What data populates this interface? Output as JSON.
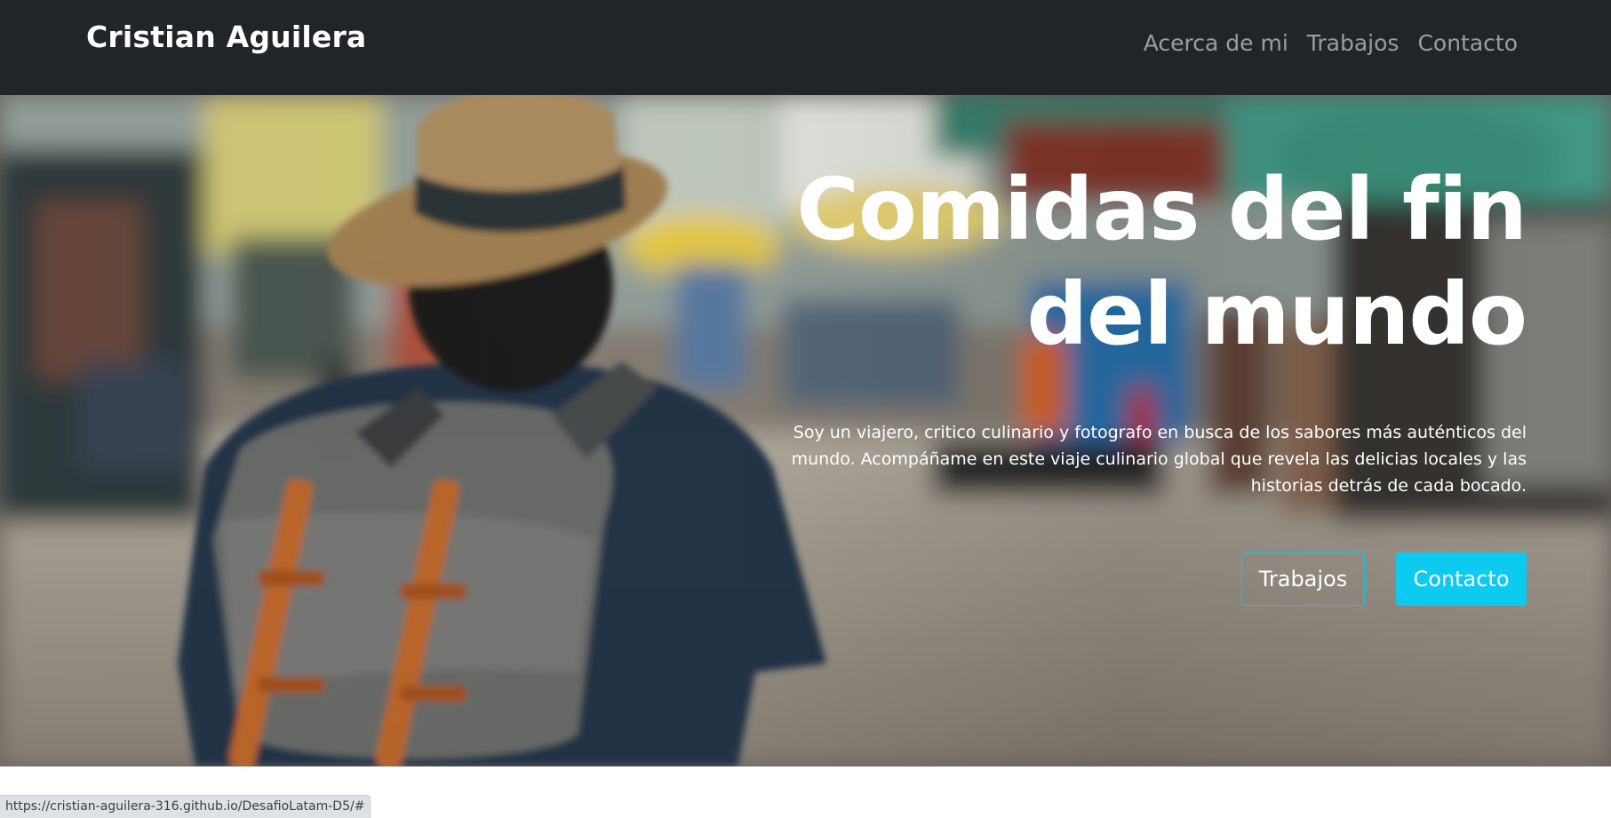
{
  "navbar": {
    "brand": "Cristian Aguilera",
    "links": [
      "Acerca de mi",
      "Trabajos",
      "Contacto"
    ]
  },
  "hero": {
    "title": "Comidas del fin del mundo",
    "description": "Soy un viajero, critico culinario y fotografo en busca de los sabores más auténticos del mundo. Acompáñame en este viaje culinario global que revela las delicias locales y las historias detrás de cada bocado.",
    "buttons": {
      "outline_label": "Trabajos",
      "solid_label": "Contacto"
    },
    "background_icon": "traveler-market-photo"
  },
  "status_bar": {
    "url": "https://cristian-aguilera-316.github.io/DesafioLatam-D5/#"
  },
  "colors": {
    "navbar_bg": "#212529",
    "accent": "#0dcaf0",
    "nav_link": "rgba(255,255,255,0.55)"
  }
}
